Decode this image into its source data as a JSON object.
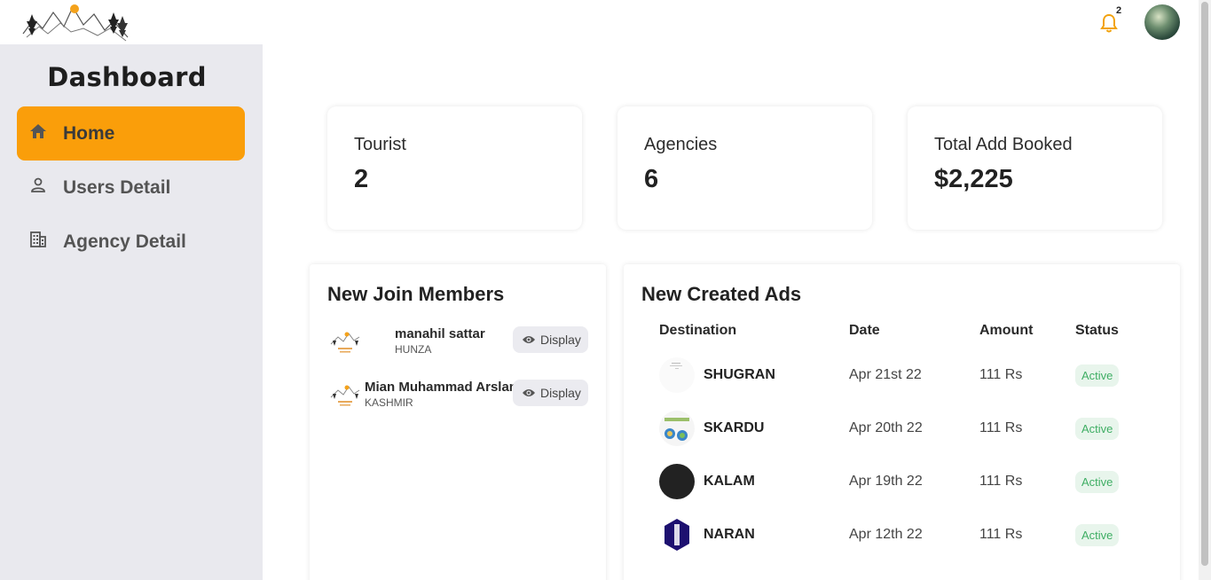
{
  "header": {
    "notification_count": "2"
  },
  "sidebar": {
    "title": "Dashboard",
    "items": [
      {
        "label": "Home",
        "icon": "home-icon",
        "active": true
      },
      {
        "label": "Users Detail",
        "icon": "user-icon",
        "active": false
      },
      {
        "label": "Agency Detail",
        "icon": "building-icon",
        "active": false
      }
    ]
  },
  "stats": [
    {
      "label": "Tourist",
      "value": "2"
    },
    {
      "label": "Agencies",
      "value": "6"
    },
    {
      "label": "Total Add Booked",
      "value": "$2,225"
    }
  ],
  "members_panel": {
    "title": "New Join Members",
    "members": [
      {
        "name": "manahil sattar",
        "location": "HUNZA",
        "button": "Display"
      },
      {
        "name": "Mian Muhammad Arslan",
        "location": "KASHMIR",
        "button": "Display"
      }
    ]
  },
  "ads_panel": {
    "title": "New Created Ads",
    "columns": [
      "Destination",
      "Date",
      "Amount",
      "Status"
    ],
    "rows": [
      {
        "destination": "SHUGRAN",
        "date": "Apr 21st 22",
        "amount": "111 Rs",
        "status": "Active"
      },
      {
        "destination": "SKARDU",
        "date": "Apr 20th 22",
        "amount": "111 Rs",
        "status": "Active"
      },
      {
        "destination": "KALAM",
        "date": "Apr 19th 22",
        "amount": "111 Rs",
        "status": "Active"
      },
      {
        "destination": "NARAN",
        "date": "Apr 12th 22",
        "amount": "111 Rs",
        "status": "Active"
      }
    ]
  },
  "colors": {
    "accent": "#fa9e0a",
    "sidebar_bg": "#e9e9ee",
    "status_green": "#3fae64",
    "bell": "#f2a20c"
  }
}
